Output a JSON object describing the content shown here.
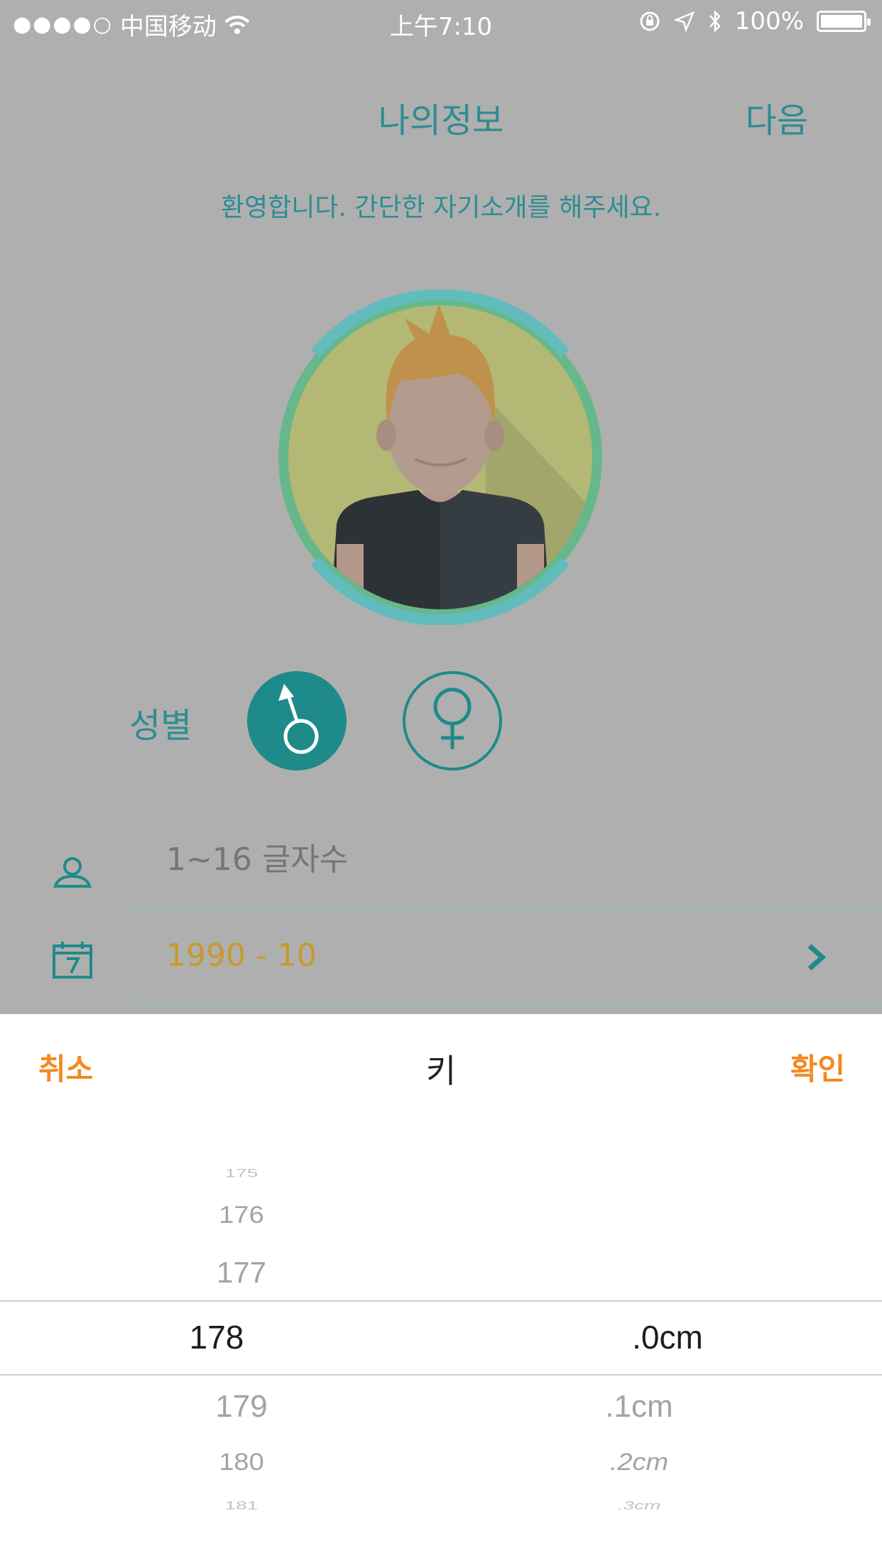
{
  "status_bar": {
    "signal_dots": "●●●●○",
    "carrier": "中国移动",
    "time": "上午7:10",
    "battery": "100%"
  },
  "nav": {
    "title": "나의정보",
    "next_label": "다음"
  },
  "welcome_text": "환영합니다. 간단한 자기소개를 해주세요.",
  "gender": {
    "label": "성별",
    "selected": "male"
  },
  "nickname": {
    "placeholder": "1~16 글자수",
    "value": ""
  },
  "birth": {
    "value": "1990 - 10"
  },
  "picker": {
    "cancel_label": "취소",
    "title": "키",
    "confirm_label": "확인",
    "integer_column": {
      "items": [
        "175",
        "176",
        "177",
        "178",
        "179",
        "180",
        "181"
      ],
      "selected": "178"
    },
    "decimal_column": {
      "items": [
        ".0cm",
        ".1cm",
        ".2cm",
        ".3cm"
      ],
      "selected": ".0cm"
    }
  },
  "colors": {
    "accent": "#2c8d92",
    "orange": "#f48a1f",
    "date": "#c79a2a",
    "overlay": "#afafaf"
  }
}
